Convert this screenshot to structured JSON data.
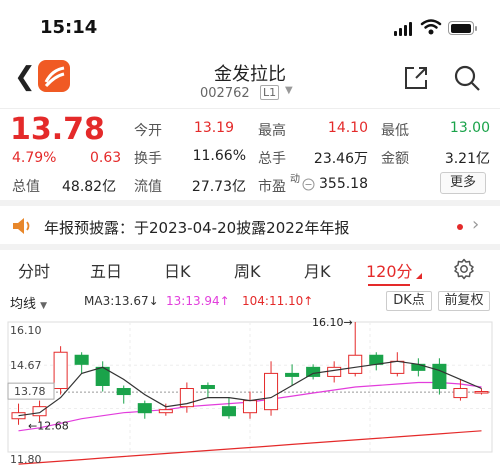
{
  "status": {
    "time": "15:14"
  },
  "nav": {
    "title": "金发拉比",
    "code": "002762",
    "level": "L1"
  },
  "quote": {
    "price": "13.78",
    "pct": "4.79%",
    "change": "0.63",
    "mcap_label": "总值",
    "mcap_value": "48.82亿",
    "fields": [
      {
        "label": "今开",
        "value": "13.19",
        "color": "#e42a2a"
      },
      {
        "label": "最高",
        "value": "14.10",
        "color": "#e42a2a"
      },
      {
        "label": "最低",
        "value": "13.00",
        "color": "#1aa34a"
      },
      {
        "label": "换手",
        "value": "11.66%",
        "color": "#222222"
      },
      {
        "label": "总手",
        "value": "23.46万",
        "color": "#222222"
      },
      {
        "label": "金额",
        "value": "3.21亿",
        "color": "#222222"
      },
      {
        "label": "流值",
        "value": "27.73亿",
        "color": "#222222"
      },
      {
        "label": "市盈",
        "value": "355.18",
        "color": "#222222"
      }
    ],
    "pe_super": "动",
    "more": "更多"
  },
  "notice": {
    "text": "年报预披露：于2023-04-20披露2022年年报"
  },
  "tabs": [
    "分时",
    "五日",
    "日K",
    "周K",
    "月K",
    "120分"
  ],
  "chart_header": {
    "selector": "均线",
    "ma3": "MA3:13.67↓",
    "ma13": "13:13.94↑",
    "ma104": "104:11.10↑",
    "dk": "DK点",
    "fq": "前复权"
  },
  "chart_data": {
    "type": "candlestick",
    "y_ticks": [
      "16.10",
      "14.67",
      "13.78",
      "11.80"
    ],
    "y_unlabeled_ticks": [
      13.24
    ],
    "ylim": [
      11.8,
      16.1
    ],
    "annotations": {
      "high": "16.10→",
      "low": "←12.68"
    },
    "last_price": 13.78,
    "candles": [
      {
        "o": 12.9,
        "c": 13.1,
        "h": 13.4,
        "l": 12.7,
        "up": true
      },
      {
        "o": 13.0,
        "c": 13.3,
        "h": 13.5,
        "l": 12.8,
        "up": true
      },
      {
        "o": 13.9,
        "c": 15.1,
        "h": 15.3,
        "l": 13.7,
        "up": true
      },
      {
        "o": 15.0,
        "c": 14.7,
        "h": 15.1,
        "l": 14.4,
        "up": false
      },
      {
        "o": 14.6,
        "c": 14.0,
        "h": 14.8,
        "l": 13.8,
        "up": false
      },
      {
        "o": 13.9,
        "c": 13.7,
        "h": 14.0,
        "l": 13.4,
        "up": false
      },
      {
        "o": 13.4,
        "c": 13.1,
        "h": 13.5,
        "l": 12.9,
        "up": false
      },
      {
        "o": 13.1,
        "c": 13.2,
        "h": 13.4,
        "l": 13.0,
        "up": true
      },
      {
        "o": 13.3,
        "c": 13.9,
        "h": 14.1,
        "l": 13.1,
        "up": true
      },
      {
        "o": 14.0,
        "c": 13.9,
        "h": 14.1,
        "l": 13.6,
        "up": false
      },
      {
        "o": 13.3,
        "c": 13.0,
        "h": 13.6,
        "l": 12.9,
        "up": false
      },
      {
        "o": 13.1,
        "c": 13.5,
        "h": 13.8,
        "l": 12.9,
        "up": true
      },
      {
        "o": 13.2,
        "c": 14.4,
        "h": 14.8,
        "l": 13.0,
        "up": true
      },
      {
        "o": 14.4,
        "c": 14.3,
        "h": 14.7,
        "l": 14.0,
        "up": false
      },
      {
        "o": 14.6,
        "c": 14.3,
        "h": 14.7,
        "l": 14.2,
        "up": false
      },
      {
        "o": 14.3,
        "c": 14.6,
        "h": 14.8,
        "l": 14.1,
        "up": true
      },
      {
        "o": 14.4,
        "c": 15.0,
        "h": 16.1,
        "l": 14.3,
        "up": true
      },
      {
        "o": 15.0,
        "c": 14.7,
        "h": 15.1,
        "l": 14.5,
        "up": false
      },
      {
        "o": 14.4,
        "c": 14.8,
        "h": 15.1,
        "l": 14.3,
        "up": true
      },
      {
        "o": 14.7,
        "c": 14.5,
        "h": 14.9,
        "l": 14.3,
        "up": false
      },
      {
        "o": 14.7,
        "c": 13.9,
        "h": 14.9,
        "l": 13.7,
        "up": false
      },
      {
        "o": 13.6,
        "c": 13.9,
        "h": 14.2,
        "l": 13.5,
        "up": true
      },
      {
        "o": 13.8,
        "c": 13.8,
        "h": 13.9,
        "l": 13.7,
        "up": true
      }
    ],
    "ma3": [
      13.0,
      13.1,
      13.6,
      14.4,
      14.6,
      14.2,
      13.7,
      13.3,
      13.4,
      13.6,
      13.6,
      13.5,
      13.6,
      14.0,
      14.4,
      14.5,
      14.6,
      14.7,
      14.8,
      14.7,
      14.5,
      14.2,
      13.9
    ],
    "ma13": [
      12.5,
      12.6,
      12.75,
      12.9,
      13.0,
      13.1,
      13.15,
      13.2,
      13.3,
      13.35,
      13.4,
      13.45,
      13.55,
      13.65,
      13.75,
      13.85,
      13.95,
      14.0,
      14.05,
      14.1,
      14.1,
      14.05,
      13.95
    ],
    "ma104": [
      11.4,
      11.45,
      11.5,
      11.55,
      11.6,
      11.65,
      11.7,
      11.75,
      11.8,
      11.85,
      11.9,
      11.95,
      12.0,
      12.05,
      12.1,
      12.15,
      12.2,
      12.25,
      12.3,
      12.35,
      12.4,
      12.45,
      12.5
    ],
    "colors": {
      "up": "#e42a2a",
      "down": "#1aa34a",
      "ma3": "#333333",
      "ma13": "#e23ddc",
      "ma104": "#e42a2a"
    }
  }
}
